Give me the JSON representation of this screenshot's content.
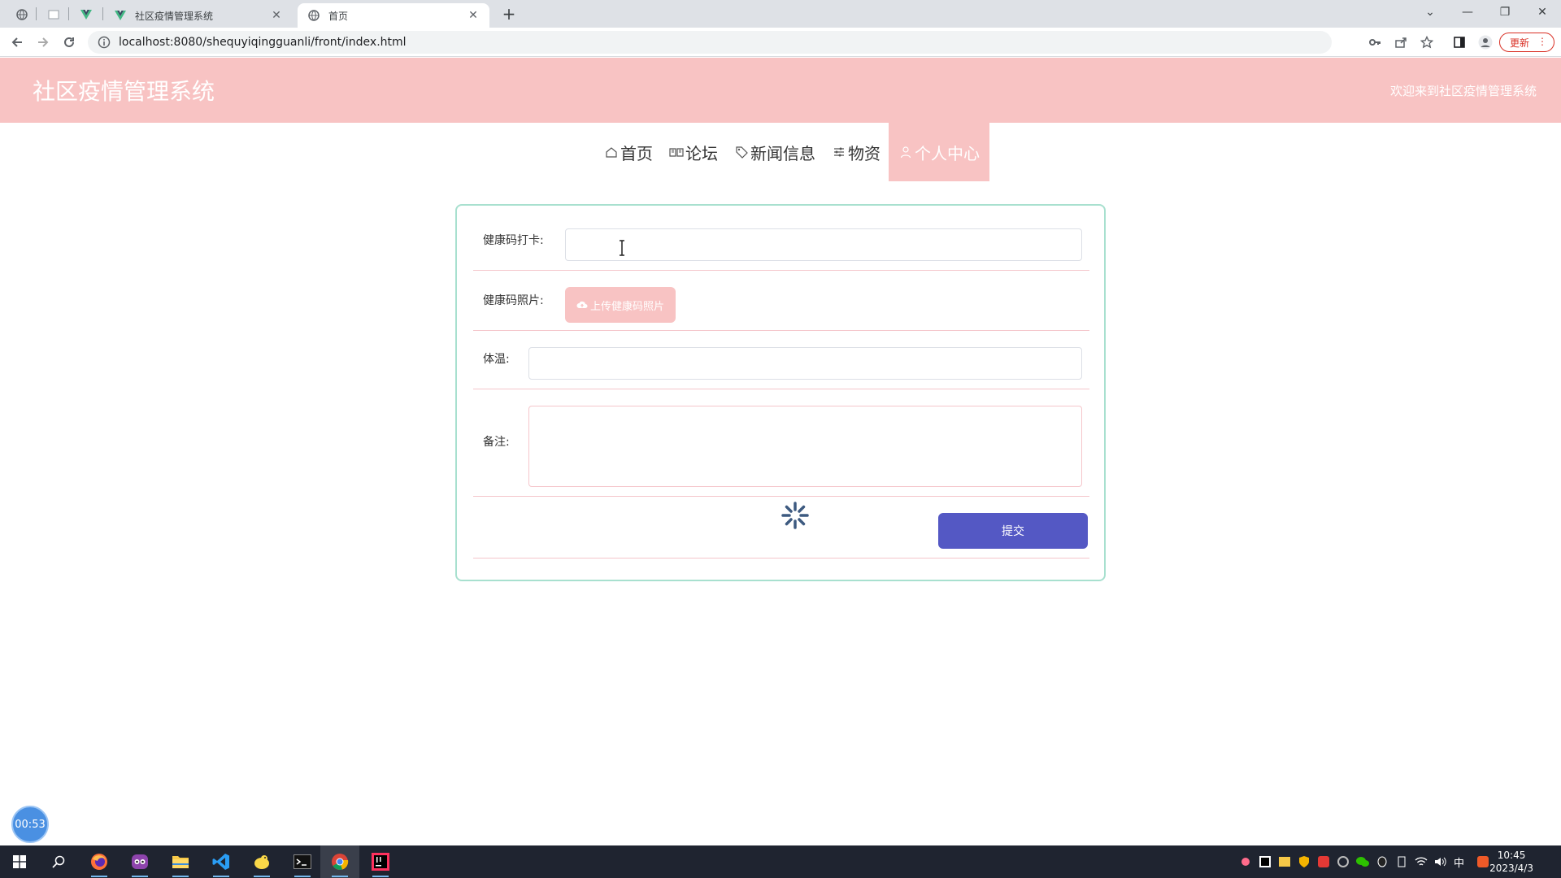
{
  "browser": {
    "tabs": [
      {
        "title": "社区疫情管理系统",
        "close": "✕"
      },
      {
        "title": "首页",
        "close": "✕"
      }
    ],
    "new_tab": "+",
    "window_controls": {
      "minimize": "—",
      "restore": "❐",
      "close": "✕",
      "tab_list": "⌄"
    },
    "address": "localhost:8080/shequyiqingguanli/front/index.html",
    "update_label": "更新",
    "update_menu": "⋮"
  },
  "site": {
    "title": "社区疫情管理系统",
    "welcome": "欢迎来到社区疫情管理系统"
  },
  "nav": {
    "items": [
      {
        "label": "首页",
        "icon": "home-icon"
      },
      {
        "label": "论坛",
        "icon": "book-icon"
      },
      {
        "label": "新闻信息",
        "icon": "tag-icon"
      },
      {
        "label": "物资",
        "icon": "sliders-icon"
      },
      {
        "label": "个人中心",
        "icon": "user-icon",
        "active": true
      }
    ]
  },
  "form": {
    "health_code_label": "健康码打卡:",
    "health_code_value": "",
    "health_photo_label": "健康码照片:",
    "upload_label": "上传健康码照片",
    "temperature_label": "体温:",
    "temperature_value": "",
    "remarks_label": "备注:",
    "remarks_value": "",
    "submit_label": "提交"
  },
  "timer": {
    "value": "00:53"
  },
  "taskbar": {
    "ime": "中",
    "time": "10:45",
    "date": "2023/4/3"
  },
  "colors": {
    "header_pink": "#f8c3c3",
    "submit_blue": "#5458c4",
    "card_border": "#a8e0cf",
    "row_divider": "#f5c6cb"
  }
}
